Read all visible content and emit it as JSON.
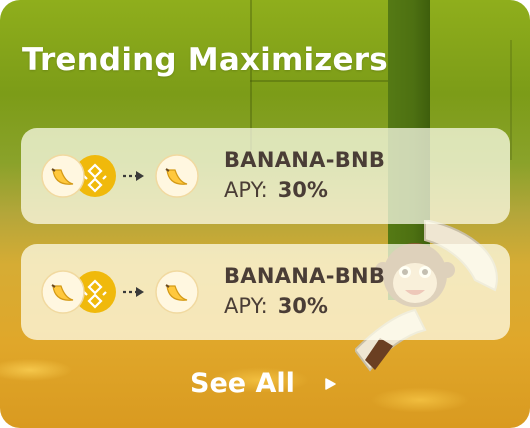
{
  "header": {
    "title": "Trending Maximizers"
  },
  "rows": [
    {
      "pair": "BANANA-BNB",
      "apy_label": "APY:",
      "apy_value": "30%"
    },
    {
      "pair": "BANANA-BNB",
      "apy_label": "APY:",
      "apy_value": "30%"
    }
  ],
  "footer": {
    "see_all_label": "See All"
  },
  "icons": {
    "input_token_1": "banana-token-icon",
    "input_token_2": "bnb-token-icon",
    "flow": "arrow-right-icon",
    "output_token": "banana-token-icon",
    "see_all": "triangle-right-icon"
  },
  "colors": {
    "text_dark": "#4a3d36",
    "title": "#ffffff",
    "bnb_gold": "#f0b90b",
    "banana_yellow": "#ffc83d"
  }
}
